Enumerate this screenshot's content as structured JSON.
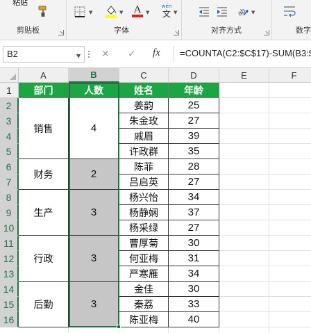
{
  "ribbon": {
    "clipboard": {
      "label": "剪贴板",
      "paste_label": "粘贴"
    },
    "font": {
      "label": "字体",
      "wen_top": "wén",
      "wen_char": "文"
    },
    "alignment": {
      "label": "对齐方式"
    },
    "number": {
      "label": "数字"
    }
  },
  "formula_bar": {
    "name_box": "B2",
    "fx_label": "fx",
    "formula": "=COUNTA(C2:$C$17)-SUM(B3:$"
  },
  "columns": [
    "A",
    "B",
    "C",
    "D",
    "E",
    "F"
  ],
  "rows": [
    "1",
    "2",
    "3",
    "4",
    "5",
    "6",
    "7",
    "8",
    "9",
    "10",
    "11",
    "12",
    "13",
    "14",
    "15",
    "16"
  ],
  "selected_column": "B",
  "table": {
    "headers": [
      "部门",
      "人数",
      "姓名",
      "年龄"
    ],
    "departments": [
      {
        "name": "销售",
        "count": "4"
      },
      {
        "name": "财务",
        "count": "2"
      },
      {
        "name": "生产",
        "count": "3"
      },
      {
        "name": "行政",
        "count": "3"
      },
      {
        "name": "后勤",
        "count": "3"
      }
    ],
    "people": [
      {
        "name": "姜韵",
        "age": "25"
      },
      {
        "name": "朱金玫",
        "age": "27"
      },
      {
        "name": "戚眉",
        "age": "39"
      },
      {
        "name": "许政群",
        "age": "35"
      },
      {
        "name": "陈菲",
        "age": "28"
      },
      {
        "name": "吕启英",
        "age": "27"
      },
      {
        "name": "杨兴怡",
        "age": "34"
      },
      {
        "name": "杨静娴",
        "age": "37"
      },
      {
        "name": "杨采绿",
        "age": "27"
      },
      {
        "name": "曹厚菊",
        "age": "30"
      },
      {
        "name": "何亚梅",
        "age": "31"
      },
      {
        "name": "严寒雁",
        "age": "34"
      },
      {
        "name": "金佳",
        "age": "30"
      },
      {
        "name": "秦荔",
        "age": "33"
      },
      {
        "name": "陈亚梅",
        "age": "40"
      }
    ]
  },
  "colors": {
    "header_fill": "#1aa640",
    "merged_gray_fill": "#c6c6c6",
    "selection_accent": "#217346",
    "font_color_bar": "#e02020",
    "highlight_bar": "#ffff00"
  }
}
